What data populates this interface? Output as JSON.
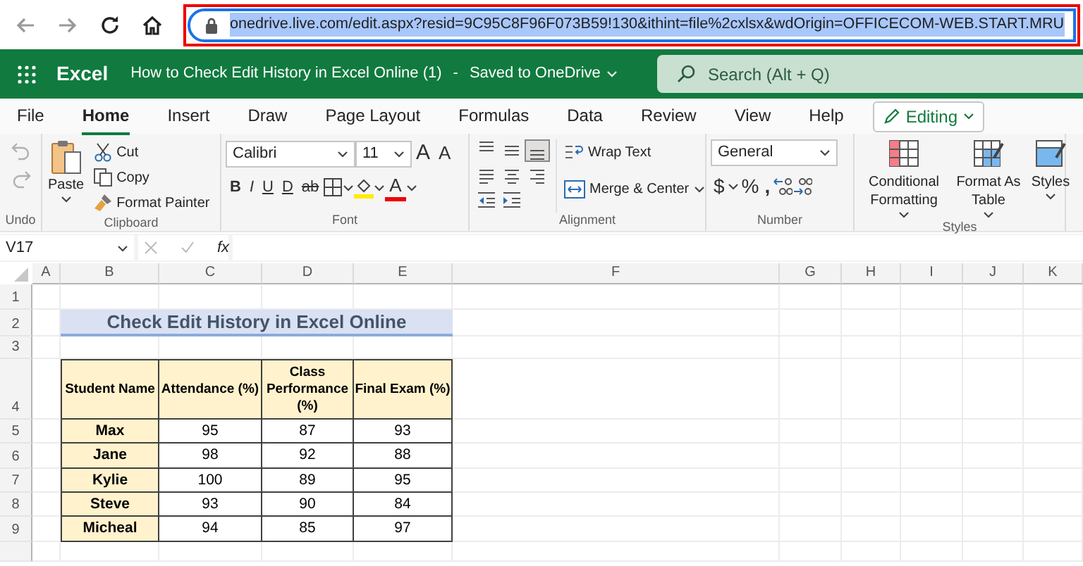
{
  "browser": {
    "url": "onedrive.live.com/edit.aspx?resid=9C95C8F96F073B59!130&ithint=file%2cxlsx&wdOrigin=OFFICECOM-WEB.START.MRU"
  },
  "app_bar": {
    "app_name": "Excel",
    "document_title": "How to Check Edit History in Excel Online (1)",
    "separator": "-",
    "save_status": "Saved to OneDrive",
    "search_placeholder": "Search (Alt + Q)"
  },
  "menu_tabs": [
    {
      "label": "File",
      "selected": false
    },
    {
      "label": "Home",
      "selected": true
    },
    {
      "label": "Insert",
      "selected": false
    },
    {
      "label": "Draw",
      "selected": false
    },
    {
      "label": "Page Layout",
      "selected": false
    },
    {
      "label": "Formulas",
      "selected": false
    },
    {
      "label": "Data",
      "selected": false
    },
    {
      "label": "Review",
      "selected": false
    },
    {
      "label": "View",
      "selected": false
    },
    {
      "label": "Help",
      "selected": false
    }
  ],
  "mode_button": "Editing",
  "ribbon": {
    "undo": {
      "label": "Undo",
      "disabled": true
    },
    "clipboard": {
      "label": "Clipboard",
      "paste": "Paste",
      "actions": [
        "Cut",
        "Copy",
        "Format Painter"
      ]
    },
    "font": {
      "label": "Font",
      "font_name": "Calibri",
      "font_size": "11",
      "grow": "A",
      "shrink": "A",
      "styles": [
        "B",
        "I",
        "U",
        "D",
        "ab"
      ],
      "font_color_letter": "A"
    },
    "alignment": {
      "label": "Alignment",
      "vertical_align": [
        {
          "selected": false
        },
        {
          "selected": false
        },
        {
          "selected": true
        }
      ],
      "wrap_text": "Wrap Text",
      "merge": "Merge & Center"
    },
    "number": {
      "label": "Number",
      "format": "General",
      "symbols": [
        "$",
        "%",
        ","
      ]
    },
    "styles": {
      "label": "Styles",
      "items": [
        "Conditional Formatting",
        "Format As Table",
        "Styles"
      ]
    }
  },
  "formula_bar": {
    "name_box": "V17",
    "function_label": "fx"
  },
  "sheet": {
    "columns": [
      "A",
      "B",
      "C",
      "D",
      "E",
      "F",
      "G",
      "H",
      "I",
      "J",
      "K"
    ],
    "rows": [
      "1",
      "2",
      "3",
      "4",
      "5",
      "6",
      "7",
      "8",
      "9"
    ],
    "title": "Check Edit History in Excel Online",
    "table": {
      "columns": [
        "Student Name",
        "Attendance (%)",
        "Class Performance (%)",
        "Final Exam (%)"
      ],
      "rows": [
        [
          "Max",
          "95",
          "87",
          "93"
        ],
        [
          "Jane",
          "98",
          "92",
          "88"
        ],
        [
          "Kylie",
          "100",
          "89",
          "95"
        ],
        [
          "Steve",
          "93",
          "90",
          "84"
        ],
        [
          "Micheal",
          "94",
          "85",
          "97"
        ]
      ]
    }
  }
}
